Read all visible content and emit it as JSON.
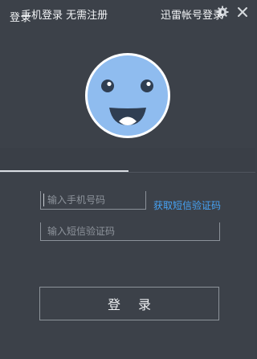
{
  "window": {
    "title": "登录"
  },
  "icons": {
    "settings": "gear-icon",
    "close": "close-icon",
    "avatar": "smiley-face-avatar"
  },
  "tabs": [
    {
      "label": "手机登录 无需注册",
      "active": true
    },
    {
      "label": "迅雷帐号登录",
      "active": false
    }
  ],
  "form": {
    "phone_placeholder": "输入手机号码",
    "phone_value": "",
    "get_code_label": "获取短信验证码",
    "code_placeholder": "输入短信验证码",
    "code_value": ""
  },
  "login_button": {
    "label": "登录"
  },
  "colors": {
    "background": "#3c4149",
    "avatar_fill": "#8fbcef",
    "link": "#46a3f5"
  }
}
